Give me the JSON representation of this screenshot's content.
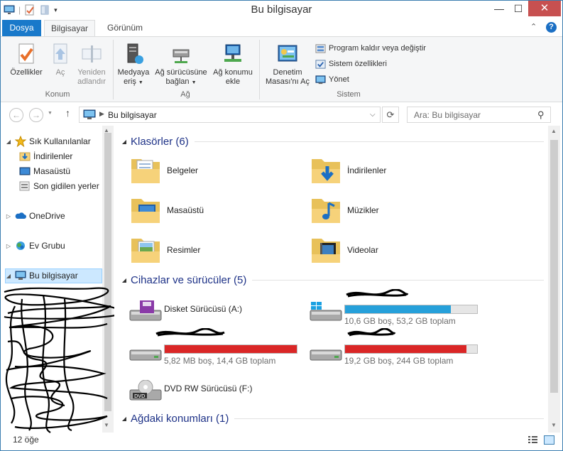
{
  "window": {
    "title": "Bu bilgisayar"
  },
  "tabs": {
    "file": "Dosya",
    "computer": "Bilgisayar",
    "view": "Görünüm"
  },
  "ribbon": {
    "properties": "Özellikler",
    "open": "Aç",
    "rename_1": "Yeniden",
    "rename_2": "adlandır",
    "media_1": "Medyaya",
    "media_2": "eriş",
    "map_drive_1": "Ağ sürücüsüne",
    "map_drive_2": "bağlan",
    "add_location_1": "Ağ konumu",
    "add_location_2": "ekle",
    "control_panel_1": "Denetim",
    "control_panel_2": "Masası'nı Aç",
    "uninstall": "Program kaldır veya değiştir",
    "system_props": "Sistem özellikleri",
    "manage": "Yönet",
    "group_location": "Konum",
    "group_network": "Ağ",
    "group_system": "Sistem"
  },
  "address": {
    "path": "Bu bilgisayar",
    "search_placeholder": "Ara: Bu bilgisayar"
  },
  "nav": {
    "favorites": "Sık Kullanılanlar",
    "downloads": "İndirilenler",
    "desktop": "Masaüstü",
    "recent": "Son gidilen yerler",
    "onedrive": "OneDrive",
    "homegroup": "Ev Grubu",
    "thispc": "Bu bilgisayar"
  },
  "folders": {
    "heading": "Klasörler (6)",
    "items": [
      "Belgeler",
      "İndirilenler",
      "Masaüstü",
      "Müzikler",
      "Resimler",
      "Videolar"
    ]
  },
  "devices": {
    "heading": "Cihazlar ve sürücüler (5)",
    "floppy": "Disket Sürücüsü (A:)",
    "drive_c": {
      "free_text": "10,6 GB boş, 53,2 GB toplam",
      "used_fraction": 0.8,
      "color": "#26a0da"
    },
    "drive_2": {
      "free_text": "5,82 MB boş, 14,4 GB toplam",
      "used_fraction": 1.0,
      "color": "#da2626"
    },
    "drive_3": {
      "free_text": "19,2 GB boş, 244 GB toplam",
      "used_fraction": 0.92,
      "color": "#da2626"
    },
    "dvd": "DVD RW Sürücüsü (F:)"
  },
  "network": {
    "heading": "Ağdaki konumları (1)"
  },
  "status": {
    "count": "12 öğe"
  }
}
